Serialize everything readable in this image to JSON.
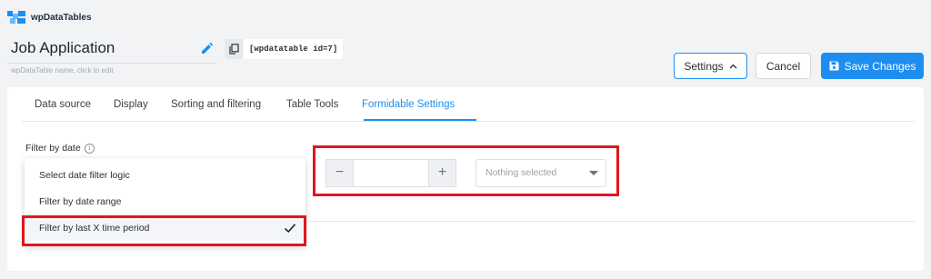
{
  "brand": {
    "name": "wpDataTables",
    "accent": "#1d8ef0",
    "highlight": "#e0161c"
  },
  "table": {
    "title": "Job Application",
    "hint": "wpDataTable name, click to edit",
    "shortcode": "[wpdatatable id=7]"
  },
  "toolbar": {
    "settings_label": "Settings",
    "cancel_label": "Cancel",
    "save_label": "Save Changes"
  },
  "tabs": [
    {
      "label": "Data source",
      "active": false
    },
    {
      "label": "Display",
      "active": false
    },
    {
      "label": "Sorting and filtering",
      "active": false
    },
    {
      "label": "Table Tools",
      "active": false
    },
    {
      "label": "Formidable Settings",
      "active": true
    }
  ],
  "filter": {
    "label": "Filter by date",
    "options": [
      {
        "label": "Select date filter logic",
        "selected": false
      },
      {
        "label": "Filter by date range",
        "selected": false
      },
      {
        "label": "Filter by last X time period",
        "selected": true
      }
    ],
    "stepper": {
      "minus": "−",
      "plus": "+",
      "value": ""
    },
    "period_select": {
      "placeholder": "Nothing selected"
    }
  },
  "icons": [
    "logo-icon",
    "pencil-icon",
    "copy-icon",
    "chevron-up-icon",
    "floppy-icon",
    "info-icon",
    "checkmark-icon",
    "caret-down-icon"
  ]
}
